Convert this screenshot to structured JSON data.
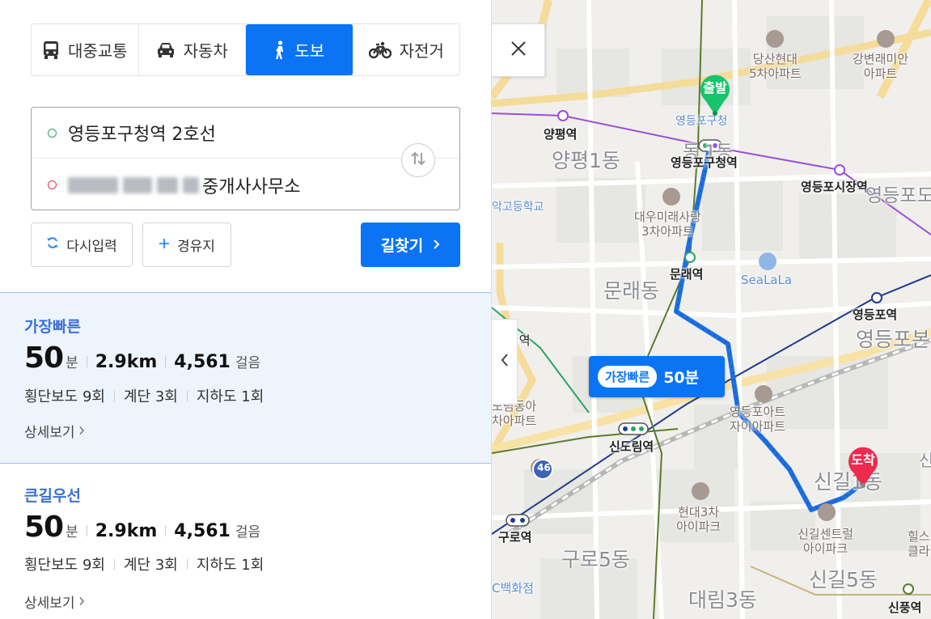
{
  "mode_tabs": [
    {
      "label": "대중교통",
      "icon": "bus-icon",
      "active": false
    },
    {
      "label": "자동차",
      "icon": "car-icon",
      "active": false
    },
    {
      "label": "도보",
      "icon": "walk-icon",
      "active": true
    },
    {
      "label": "자전거",
      "icon": "bicycle-icon",
      "active": false
    }
  ],
  "route": {
    "start": "영등포구청역 2호선",
    "destination_suffix": "중개사사무소"
  },
  "buttons": {
    "reset": "다시입력",
    "waypoint": "경유지",
    "search": "길찾기"
  },
  "results": [
    {
      "label": "가장빠른",
      "time": "50",
      "time_unit": "분",
      "distance": "2.9km",
      "steps": "4,561",
      "steps_unit": "걸음",
      "crosswalk": "횡단보도 9회",
      "stairs": "계단 3회",
      "underpass": "지하도 1회",
      "detail": "상세보기"
    },
    {
      "label": "큰길우선",
      "time": "50",
      "time_unit": "분",
      "distance": "2.9km",
      "steps": "4,561",
      "steps_unit": "걸음",
      "crosswalk": "횡단보도 9회",
      "stairs": "계단 3회",
      "underpass": "지하도 1회",
      "detail": "상세보기"
    }
  ],
  "map": {
    "route_tag": {
      "label": "가장빠른",
      "time": "50분"
    },
    "start_pin": "출발",
    "end_pin": "도착",
    "labels": {
      "dangsan": "당산현대\n5차아파트",
      "gangbyeon": "강변래미안\n아파트",
      "gucheong_office": "영등포구청",
      "yangpyeong_st": "양평역",
      "yangpyeong1": "양평1동",
      "dong1_partial": "동 1동",
      "gucheong_st": "영등포구청역",
      "market_st": "영등포시장역",
      "yeongdeungpodo": "영등포도동",
      "school": "악고등학교",
      "daewoo": "대우미래사랑\n3차아파트",
      "mullae_st": "문래역",
      "sealala": "SeaLaLa",
      "mullaedong": "문래동",
      "yeongdeungpo_st": "영등포역",
      "yeongdeungpobon": "영등포본",
      "left_station": "천역",
      "fort_apt": "영등포아트\n자이아파트",
      "sindorim_apt": "도림동아\n차아파트",
      "sindorim_st": "신도림역",
      "road46": "46",
      "singil": "신길1동",
      "hyundai3": "현대3차\n아이파크",
      "guro_st": "구로역",
      "guro5": "구로5동",
      "singil_central": "신길센트럴\n아이파크",
      "hills": "힐스\n클라",
      "dept": "C백화점",
      "daerim3": "대림3동",
      "singil5": "신길5동",
      "sinpung_st": "신풍역",
      "edge_sin": "신"
    }
  },
  "colors": {
    "primary": "#0a74f4",
    "route": "#1e6fe0",
    "start_pin": "#17c46c",
    "end_pin": "#ee2a4d",
    "line5": "#9b4fd8",
    "line7": "#5a7d2a",
    "line1": "#1f3c8c"
  }
}
